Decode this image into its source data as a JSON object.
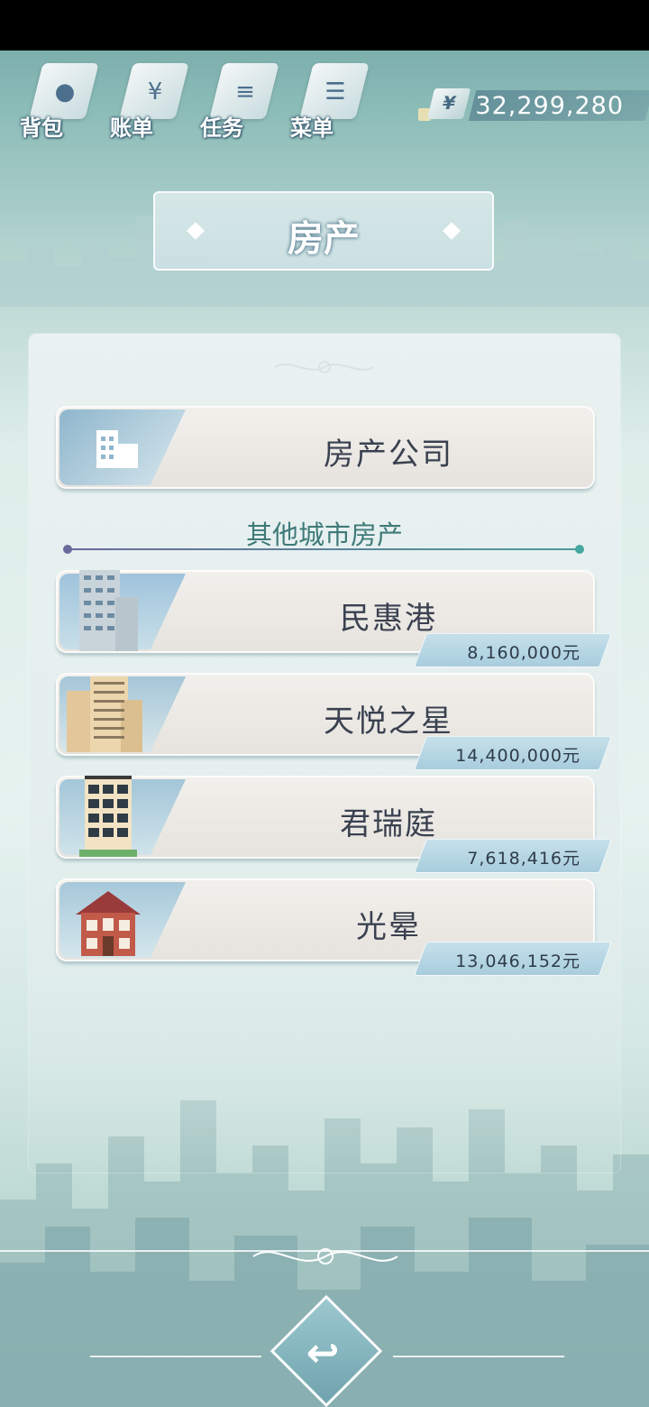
{
  "nav": [
    {
      "label": "背包",
      "icon": "bag-icon",
      "glyph": "●"
    },
    {
      "label": "账单",
      "icon": "bill-icon",
      "glyph": "¥"
    },
    {
      "label": "任务",
      "icon": "task-icon",
      "glyph": "≡"
    },
    {
      "label": "菜单",
      "icon": "menu-icon",
      "glyph": "☰"
    }
  ],
  "money": {
    "symbol": "¥",
    "value": "32,299,280"
  },
  "page_title": "房产",
  "company_button": {
    "label": "房产公司",
    "icon": "building-icon"
  },
  "section_title": "其他城市房产",
  "properties": [
    {
      "name": "民惠港",
      "price": "8,160,000元",
      "icon": "apartment-tower-icon"
    },
    {
      "name": "天悦之星",
      "price": "14,400,000元",
      "icon": "apartment-block-icon"
    },
    {
      "name": "君瑞庭",
      "price": "7,618,416元",
      "icon": "highrise-icon"
    },
    {
      "name": "光晕",
      "price": "13,046,152元",
      "icon": "house-icon"
    }
  ],
  "back_button": {
    "glyph": "↩",
    "icon": "back-arrow-icon"
  },
  "colors": {
    "accent": "#4f9c98",
    "title_text": "#3a4150",
    "section": "#3e7a78"
  }
}
